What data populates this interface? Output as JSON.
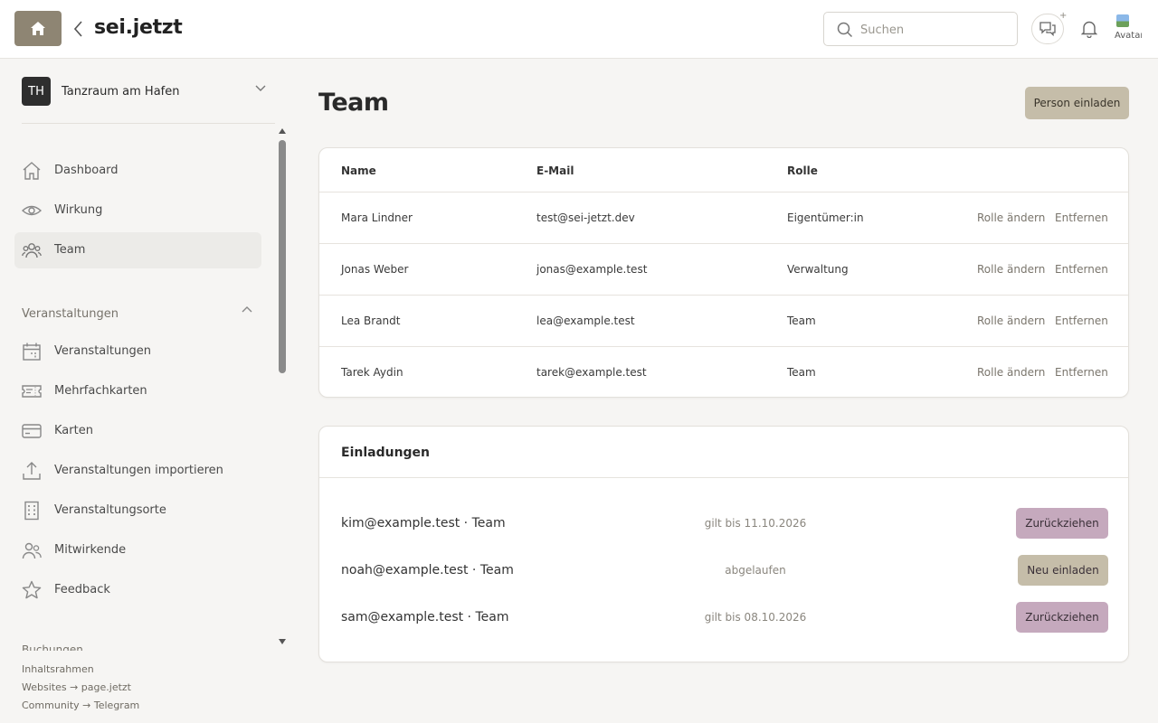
{
  "header": {
    "brand": "sei.jetzt",
    "search_placeholder": "Suchen",
    "chat_plus": "+",
    "avatar_alt": "Avatar"
  },
  "sidebar": {
    "org_initials": "TH",
    "org_name": "Tanzraum am Hafen",
    "nav": [
      {
        "label": "Dashboard",
        "icon": "home-icon"
      },
      {
        "label": "Wirkung",
        "icon": "eye-icon"
      },
      {
        "label": "Team",
        "icon": "users-icon",
        "active": true
      }
    ],
    "section_events": {
      "label": "Veranstaltungen",
      "items": [
        {
          "label": "Veranstaltungen",
          "icon": "calendar-icon"
        },
        {
          "label": "Mehrfachkarten",
          "icon": "ticket-icon"
        },
        {
          "label": "Karten",
          "icon": "card-icon"
        },
        {
          "label": "Veranstaltungen importieren",
          "icon": "upload-icon"
        },
        {
          "label": "Veranstaltungsorte",
          "icon": "building-icon"
        },
        {
          "label": "Mitwirkende",
          "icon": "people-icon"
        },
        {
          "label": "Feedback",
          "icon": "star-icon"
        }
      ]
    },
    "cut_section": "Buchungen",
    "footer": [
      "Inhaltsrahmen",
      "Websites → page.jetzt",
      "Community → Telegram"
    ]
  },
  "main": {
    "title": "Team",
    "invite_button": "Person einladen",
    "table": {
      "columns": [
        "Name",
        "E-Mail",
        "Rolle"
      ],
      "action_change": "Rolle ändern",
      "action_remove": "Entfernen",
      "rows": [
        {
          "name": "Mara Lindner",
          "email": "test@sei-jetzt.dev",
          "role": "Eigentümer:in"
        },
        {
          "name": "Jonas Weber",
          "email": "jonas@example.test",
          "role": "Verwaltung"
        },
        {
          "name": "Lea Brandt",
          "email": "lea@example.test",
          "role": "Team"
        },
        {
          "name": "Tarek Aydin",
          "email": "tarek@example.test",
          "role": "Team"
        }
      ]
    },
    "invitations": {
      "title": "Einladungen",
      "items": [
        {
          "label": "kim@example.test · Team",
          "status": "gilt bis 11.10.2026",
          "button": "Zurückziehen",
          "kind": "revoke"
        },
        {
          "label": "noah@example.test · Team",
          "status": "abgelaufen",
          "button": "Neu einladen",
          "kind": "reinvite"
        },
        {
          "label": "sam@example.test · Team",
          "status": "gilt bis 08.10.2026",
          "button": "Zurückziehen",
          "kind": "revoke"
        }
      ]
    }
  },
  "colors": {
    "home_button": "#8e8573",
    "primary_button": "#c5bda9",
    "revoke_button": "#c5a9bd",
    "background": "#f6f5f3"
  }
}
